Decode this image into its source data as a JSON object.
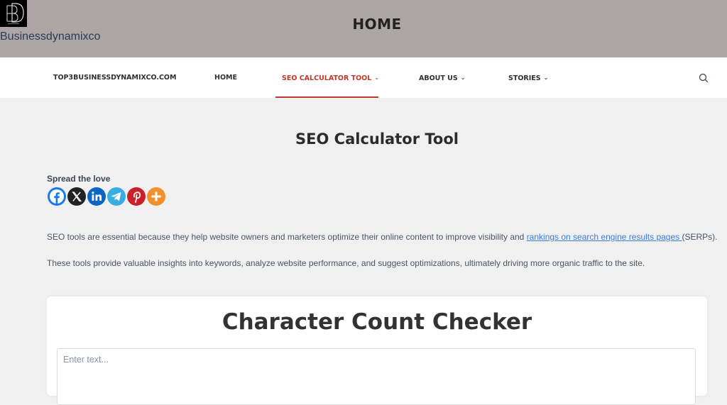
{
  "header": {
    "brand_name": "Businessdynamixco",
    "site_title": "HOME",
    "background_color": "#ada5a6"
  },
  "nav": {
    "items": [
      {
        "label": "TOP3BUSINESSDYNAMIXCO.COM",
        "has_dropdown": false,
        "active": false
      },
      {
        "label": "HOME",
        "has_dropdown": false,
        "active": false
      },
      {
        "label": "SEO CALCULATOR TOOL",
        "has_dropdown": true,
        "active": true
      },
      {
        "label": "ABOUT US",
        "has_dropdown": true,
        "active": false
      },
      {
        "label": "STORIES",
        "has_dropdown": true,
        "active": false
      }
    ],
    "active_color": "#c0392b",
    "search_icon": "search-icon"
  },
  "main": {
    "page_title": "SEO Calculator Tool",
    "spread_label": "Spread the love",
    "share_icons": [
      {
        "name": "facebook-icon",
        "color": "#1877f2"
      },
      {
        "name": "x-icon",
        "color": "#222222"
      },
      {
        "name": "linkedin-icon",
        "color": "#0a66c2"
      },
      {
        "name": "telegram-icon",
        "color": "#37aee2"
      },
      {
        "name": "pinterest-icon",
        "color": "#cb2027"
      },
      {
        "name": "more-icon",
        "color": "#f0902e"
      }
    ],
    "paragraph1": {
      "before": "SEO tools are essential because they help website owners and marketers optimize their online content to improve visibility and ",
      "link": "rankings on search engine results pages ",
      "after": "(SERPs)."
    },
    "paragraph2": "These tools provide valuable insights into keywords, analyze website performance, and suggest optimizations, ultimately driving more organic traffic to the site."
  },
  "tool": {
    "title": "Character Count Checker",
    "input_placeholder": "Enter text...",
    "input_value": ""
  }
}
